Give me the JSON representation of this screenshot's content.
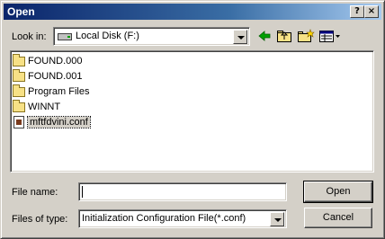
{
  "window": {
    "title": "Open",
    "help_label": "?",
    "close_label": "×"
  },
  "look_in": {
    "label": "Look in:",
    "value": "Local Disk (F:)",
    "drive_icon": "drive-icon"
  },
  "toolbar": {
    "icons": [
      "back-arrow-icon",
      "up-folder-icon",
      "new-folder-icon",
      "view-menu-icon"
    ]
  },
  "files": [
    {
      "name": "FOUND.000",
      "type": "folder",
      "icon": "folder-icon"
    },
    {
      "name": "FOUND.001",
      "type": "folder",
      "icon": "folder-icon"
    },
    {
      "name": "Program Files",
      "type": "folder",
      "icon": "folder-icon"
    },
    {
      "name": "WINNT",
      "type": "folder",
      "icon": "folder-icon"
    },
    {
      "name": "mftfdvini.conf",
      "type": "file",
      "icon": "config-file-icon",
      "selected": true
    }
  ],
  "file_name": {
    "label": "File name:",
    "value": ""
  },
  "files_of_type": {
    "label": "Files of type:",
    "value": "Initialization Configuration File(*.conf)"
  },
  "buttons": {
    "open": "Open",
    "cancel": "Cancel"
  },
  "colors": {
    "title_bar": "#0a246a",
    "window_bg": "#d4d0c8"
  }
}
